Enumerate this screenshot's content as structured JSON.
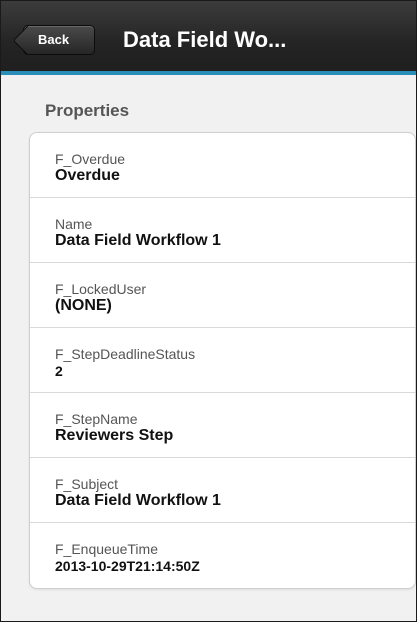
{
  "header": {
    "back_label": "Back",
    "title": "Data Field Wo..."
  },
  "section": {
    "label": "Properties"
  },
  "properties": [
    {
      "key": "F_Overdue",
      "value": "Overdue"
    },
    {
      "key": "Name",
      "value": "Data Field Workflow 1"
    },
    {
      "key": "F_LockedUser",
      "value": "(NONE)"
    },
    {
      "key": "F_StepDeadlineStatus",
      "value": "2"
    },
    {
      "key": "F_StepName",
      "value": "Reviewers Step"
    },
    {
      "key": "F_Subject",
      "value": "Data Field Workflow 1"
    },
    {
      "key": "F_EnqueueTime",
      "value": "2013-10-29T21:14:50Z"
    }
  ],
  "colors": {
    "header_accent": "#2a8fb8",
    "header_background": "#2a2a2a"
  }
}
